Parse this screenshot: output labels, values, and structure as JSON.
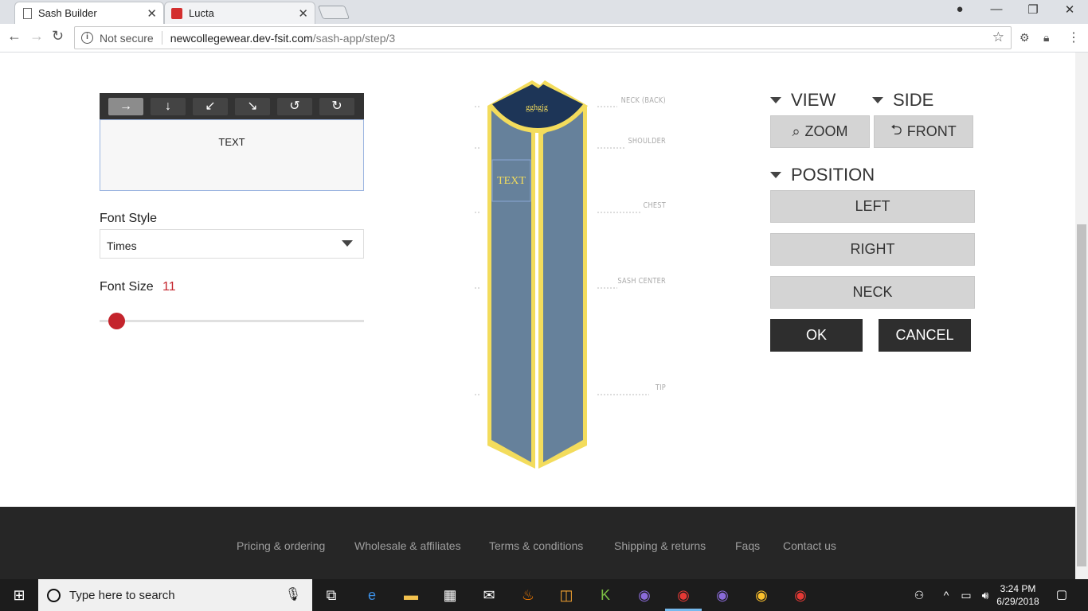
{
  "browser": {
    "tabs": [
      {
        "title": "Sash Builder",
        "active": true
      },
      {
        "title": "Lucta",
        "active": false
      }
    ],
    "security": "Not secure",
    "url_host": "newcollegewear.dev-fsit.com",
    "url_path": "/sash-app/step/3"
  },
  "text_panel": {
    "direction_buttons": [
      {
        "name": "right-arrow-icon",
        "glyph": "→",
        "selected": true
      },
      {
        "name": "down-arrow-icon",
        "glyph": "↓",
        "selected": false
      },
      {
        "name": "down-left-arrow-icon",
        "glyph": "↙",
        "selected": false
      },
      {
        "name": "down-right-arrow-icon",
        "glyph": "↘",
        "selected": false
      },
      {
        "name": "rotate-left-icon",
        "glyph": "↺",
        "selected": false
      },
      {
        "name": "rotate-right-icon",
        "glyph": "↻",
        "selected": false
      }
    ],
    "text_value": "TEXT",
    "font_style_label": "Font Style",
    "font_style_value": "Times",
    "font_size_label": "Font Size",
    "font_size_value": "11",
    "font_size_slider_fraction": 0.07
  },
  "sash": {
    "neck_text": "gghgjg",
    "body_text": "TEXT",
    "labels": [
      "NECK (BACK)",
      "SHOULDER",
      "CHEST",
      "SASH CENTER",
      "TIP"
    ],
    "colors": {
      "body": "#66819b",
      "trim": "#f3dc5c",
      "neck": "#1d3557"
    }
  },
  "controls": {
    "view_label": "VIEW",
    "side_label": "SIDE",
    "zoom_label": "ZOOM",
    "front_label": "FRONT",
    "position_label": "POSITION",
    "left_label": "LEFT",
    "right_label": "RIGHT",
    "neck_label": "NECK",
    "ok_label": "OK",
    "cancel_label": "CANCEL"
  },
  "footer": {
    "links": [
      "Pricing & ordering",
      "Wholesale & affiliates",
      "Terms & conditions",
      "Shipping & returns",
      "Faqs",
      "Contact us"
    ]
  },
  "taskbar": {
    "search_placeholder": "Type here to search",
    "time": "3:24 PM",
    "date": "6/29/2018"
  }
}
